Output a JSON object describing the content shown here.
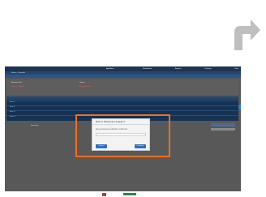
{
  "header": {
    "app_title": "AppName",
    "links": [
      "Dashboard",
      "Reports",
      "Settings",
      "Help"
    ]
  },
  "nav": {
    "breadcrumb": "Home > Records"
  },
  "panel": {
    "left_label": "Request Info",
    "left_value": "Status: Pending",
    "mid_label": "Owner",
    "mid_value": "Assigned user"
  },
  "section": {
    "rows": [
      "Item 1",
      "Item 2",
      "Item 3",
      "Item 4"
    ]
  },
  "lower": {
    "label": "Summary"
  },
  "modal": {
    "title": "Rule to Temporary Suspend",
    "body": "Are you sure you want to continue?",
    "cancel_label": "Cancel",
    "confirm_label": "Continue"
  },
  "colors": {
    "highlight": "#f07022",
    "arrow": "#bfbfbf",
    "topbar": "#1b3557"
  },
  "icons": {
    "arrow": "turn-right-arrow-icon"
  }
}
